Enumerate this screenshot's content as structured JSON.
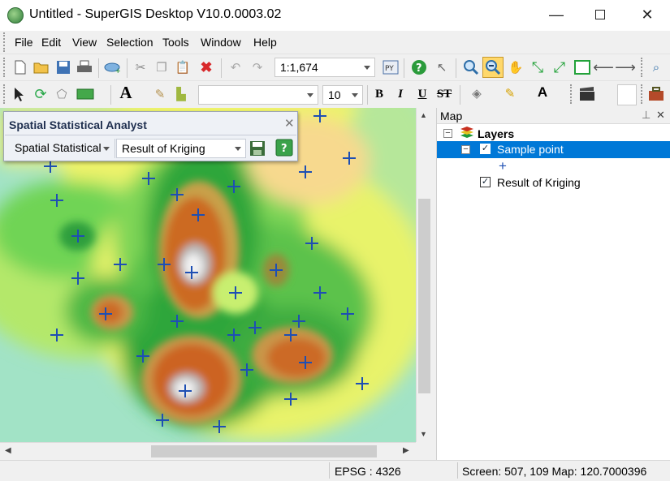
{
  "window": {
    "title": "Untitled - SuperGIS Desktop V10.0.0003.02"
  },
  "menu": [
    "File",
    "Edit",
    "View",
    "Selection",
    "Tools",
    "Window",
    "Help"
  ],
  "toolbar": {
    "scale": "1:1,674",
    "font_size": "10"
  },
  "ssa": {
    "title": "Spatial Statistical Analyst",
    "tool": "Spatial Statistical",
    "layer": "Result of Kriging"
  },
  "map_panel": {
    "title": "Map",
    "root": "Layers",
    "layers": [
      "Sample point",
      "Result of Kriging"
    ]
  },
  "status": {
    "epsg": "EPSG : 4326",
    "coords": "Screen: 507, 109  Map: 120.7000396"
  },
  "chart_data": {
    "type": "scatter",
    "title": "",
    "series": [
      {
        "values": [
          [
            394,
            143
          ],
          [
            430,
            195
          ],
          [
            62,
            205
          ],
          [
            183,
            220
          ],
          [
            376,
            212
          ],
          [
            288,
            230
          ],
          [
            70,
            247
          ],
          [
            218,
            240
          ],
          [
            244,
            265
          ],
          [
            96,
            291
          ],
          [
            384,
            300
          ],
          [
            148,
            326
          ],
          [
            202,
            326
          ],
          [
            340,
            333
          ],
          [
            236,
            336
          ],
          [
            96,
            343
          ],
          [
            290,
            361
          ],
          [
            394,
            361
          ],
          [
            130,
            387
          ],
          [
            428,
            387
          ],
          [
            218,
            396
          ],
          [
            368,
            396
          ],
          [
            314,
            404
          ],
          [
            70,
            413
          ],
          [
            288,
            413
          ],
          [
            358,
            413
          ],
          [
            176,
            439
          ],
          [
            376,
            447
          ],
          [
            304,
            456
          ],
          [
            446,
            473
          ],
          [
            228,
            482
          ],
          [
            358,
            492
          ],
          [
            200,
            518
          ],
          [
            270,
            526
          ]
        ]
      }
    ]
  }
}
